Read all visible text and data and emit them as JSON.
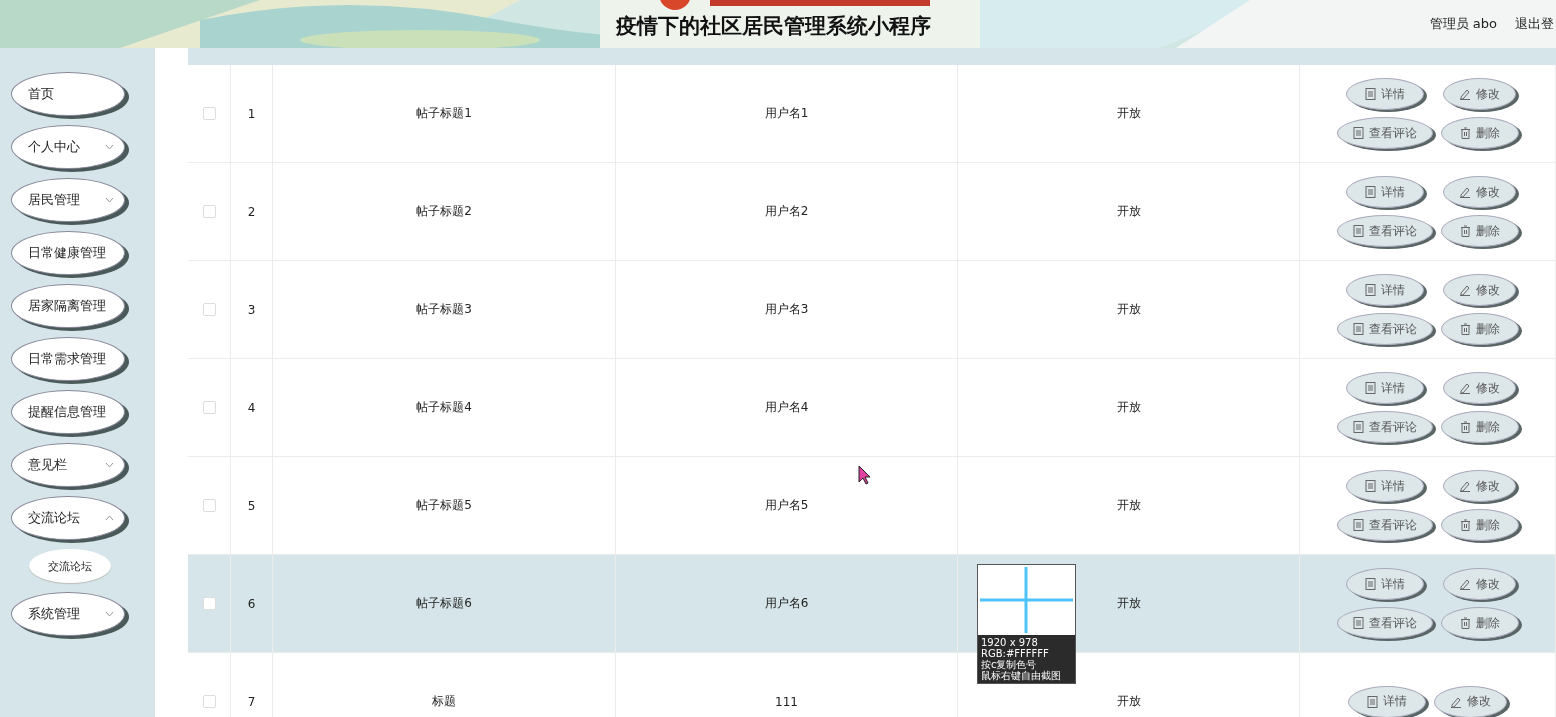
{
  "header": {
    "title": "疫情下的社区居民管理系统小程序",
    "user": "管理员 abo",
    "logout": "退出登"
  },
  "sidebar": {
    "items": [
      {
        "label": "首页",
        "kind": "link"
      },
      {
        "label": "个人中心",
        "kind": "menu",
        "expanded": false
      },
      {
        "label": "居民管理",
        "kind": "menu",
        "expanded": false
      },
      {
        "label": "日常健康管理",
        "kind": "link"
      },
      {
        "label": "居家隔离管理",
        "kind": "link"
      },
      {
        "label": "日常需求管理",
        "kind": "link"
      },
      {
        "label": "提醒信息管理",
        "kind": "link"
      },
      {
        "label": "意见栏",
        "kind": "menu",
        "expanded": false
      },
      {
        "label": "交流论坛",
        "kind": "menu",
        "expanded": true,
        "children": [
          {
            "label": "交流论坛"
          }
        ]
      },
      {
        "label": "系统管理",
        "kind": "menu",
        "expanded": false
      }
    ]
  },
  "table": {
    "rows": [
      {
        "index": "1",
        "title": "帖子标题1",
        "user": "用户名1",
        "status": "开放",
        "highlighted": false,
        "checked": false,
        "actions": [
          {
            "kind": "detail",
            "label": "详情"
          },
          {
            "kind": "edit",
            "label": "修改"
          },
          {
            "kind": "comments",
            "label": "查看评论"
          },
          {
            "kind": "delete",
            "label": "删除"
          }
        ]
      },
      {
        "index": "2",
        "title": "帖子标题2",
        "user": "用户名2",
        "status": "开放",
        "highlighted": false,
        "checked": false,
        "actions": [
          {
            "kind": "detail",
            "label": "详情"
          },
          {
            "kind": "edit",
            "label": "修改"
          },
          {
            "kind": "comments",
            "label": "查看评论"
          },
          {
            "kind": "delete",
            "label": "删除"
          }
        ]
      },
      {
        "index": "3",
        "title": "帖子标题3",
        "user": "用户名3",
        "status": "开放",
        "highlighted": false,
        "checked": false,
        "actions": [
          {
            "kind": "detail",
            "label": "详情"
          },
          {
            "kind": "edit",
            "label": "修改"
          },
          {
            "kind": "comments",
            "label": "查看评论"
          },
          {
            "kind": "delete",
            "label": "删除"
          }
        ]
      },
      {
        "index": "4",
        "title": "帖子标题4",
        "user": "用户名4",
        "status": "开放",
        "highlighted": false,
        "checked": false,
        "actions": [
          {
            "kind": "detail",
            "label": "详情"
          },
          {
            "kind": "edit",
            "label": "修改"
          },
          {
            "kind": "comments",
            "label": "查看评论"
          },
          {
            "kind": "delete",
            "label": "删除"
          }
        ]
      },
      {
        "index": "5",
        "title": "帖子标题5",
        "user": "用户名5",
        "status": "开放",
        "highlighted": false,
        "checked": false,
        "actions": [
          {
            "kind": "detail",
            "label": "详情"
          },
          {
            "kind": "edit",
            "label": "修改"
          },
          {
            "kind": "comments",
            "label": "查看评论"
          },
          {
            "kind": "delete",
            "label": "删除"
          }
        ]
      },
      {
        "index": "6",
        "title": "帖子标题6",
        "user": "用户名6",
        "status": "开放",
        "highlighted": true,
        "checked": false,
        "actions": [
          {
            "kind": "detail",
            "label": "详情"
          },
          {
            "kind": "edit",
            "label": "修改"
          },
          {
            "kind": "comments",
            "label": "查看评论"
          },
          {
            "kind": "delete",
            "label": "删除"
          }
        ]
      },
      {
        "index": "7",
        "title": "标题",
        "user": "111",
        "status": "开放",
        "highlighted": false,
        "checked": false,
        "actions": [
          {
            "kind": "detail",
            "label": "详情"
          },
          {
            "kind": "edit",
            "label": "修改"
          }
        ]
      }
    ]
  },
  "color_picker": {
    "lines": [
      "1920 x 978",
      "RGB:#FFFFFF",
      "按c复制色号",
      "鼠标右键自由截图"
    ]
  }
}
